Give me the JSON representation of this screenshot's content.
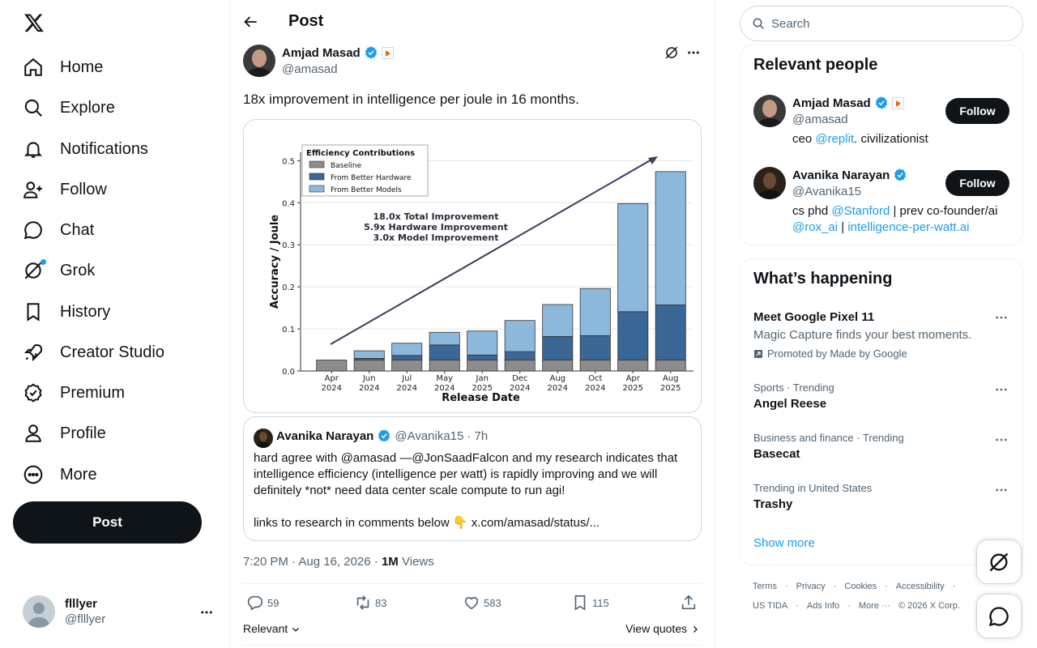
{
  "nav": {
    "items": [
      {
        "label": "Home",
        "icon": "home-icon"
      },
      {
        "label": "Explore",
        "icon": "search-icon"
      },
      {
        "label": "Notifications",
        "icon": "bell-icon"
      },
      {
        "label": "Follow",
        "icon": "person-add-icon"
      },
      {
        "label": "Chat",
        "icon": "chat-icon"
      },
      {
        "label": "Grok",
        "icon": "grok-icon"
      },
      {
        "label": "History",
        "icon": "bookmark-icon"
      },
      {
        "label": "Creator Studio",
        "icon": "rocket-icon"
      },
      {
        "label": "Premium",
        "icon": "verified-badge-icon"
      },
      {
        "label": "Profile",
        "icon": "person-icon"
      },
      {
        "label": "More",
        "icon": "more-circle-icon"
      }
    ],
    "post_button": "Post",
    "account": {
      "name": "flllyer",
      "handle": "@flllyer"
    }
  },
  "header": {
    "title": "Post"
  },
  "tweet": {
    "author": {
      "name": "Amjad Masad",
      "handle": "@amasad"
    },
    "text": "18x improvement in intelligence per joule in 16 months.",
    "quote": {
      "author": "Avanika Narayan",
      "handle": "@Avanika15",
      "time": "· 7h",
      "line1": "hard agree with @amasad —@JonSaadFalcon and my research indicates that",
      "line2": "intelligence efficiency (intelligence per watt) is rapidly improving and we will",
      "line3": "definitely *not* need data center scale compute to run agi!",
      "line4": "links to research in comments below 👇 x.com/amasad/status/..."
    },
    "timestamp": "7:20 PM · Aug 16, 2026 ·",
    "views_count": "1M",
    "views_label": "Views",
    "stats": {
      "replies": "59",
      "reposts": "83",
      "likes": "583",
      "bookmarks": "115"
    },
    "sort_label": "Relevant",
    "view_quotes": "View quotes"
  },
  "chart_data": {
    "type": "bar",
    "stacked": true,
    "xlabel": "Release Date",
    "ylabel": "Accuracy / Joule",
    "ylim": [
      0,
      0.52
    ],
    "yticks": [
      "0.0",
      "0.1",
      "0.2",
      "0.3",
      "0.4",
      "0.5"
    ],
    "legend_title": "Efficiency Contributions",
    "legend_position": "top-left",
    "categories": [
      [
        "Apr",
        "2024"
      ],
      [
        "Jun",
        "2024"
      ],
      [
        "Jul",
        "2024"
      ],
      [
        "May",
        "2024"
      ],
      [
        "Jan",
        "2025"
      ],
      [
        "Dec",
        "2024"
      ],
      [
        "Aug",
        "2024"
      ],
      [
        "Oct",
        "2024"
      ],
      [
        "Apr",
        "2025"
      ],
      [
        "Aug",
        "2025"
      ]
    ],
    "series": [
      {
        "name": "Baseline",
        "color": "#8c8c8c",
        "values": [
          0.026,
          0.026,
          0.026,
          0.026,
          0.026,
          0.026,
          0.026,
          0.026,
          0.026,
          0.026
        ]
      },
      {
        "name": "From Better Hardware",
        "color": "#3b6796",
        "values": [
          0.0,
          0.004,
          0.011,
          0.036,
          0.012,
          0.02,
          0.056,
          0.058,
          0.115,
          0.131
        ]
      },
      {
        "name": "From Better Models",
        "color": "#8cb8dc",
        "values": [
          0.0,
          0.018,
          0.029,
          0.03,
          0.057,
          0.074,
          0.076,
          0.112,
          0.257,
          0.317
        ]
      }
    ],
    "annotations": [
      "18.0x Total Improvement",
      "5.9x Hardware Improvement",
      "3.0x Model Improvement"
    ]
  },
  "sidebar": {
    "search_placeholder": "Search",
    "relevant_title": "Relevant people",
    "people": [
      {
        "name": "Amjad Masad",
        "handle": "@amasad",
        "bio_a": "ceo ",
        "bio_link": "@replit",
        "bio_b": ". civilizationist",
        "follow": "Follow"
      },
      {
        "name": "Avanika Narayan",
        "handle": "@Avanika15",
        "bio_a": "cs phd ",
        "bio_link": "@Stanford",
        "bio_b": " | prev co-founder/ai",
        "bio_link2": "@rox_ai",
        "bio_c": " | ",
        "bio_link3": "intelligence-per-watt.ai",
        "follow": "Follow"
      }
    ],
    "happening_title": "What’s happening",
    "trends": [
      {
        "name": "Meet Google Pixel 11",
        "sub": "Magic Capture finds your best moments.",
        "promo": "Promoted by Made by Google"
      },
      {
        "context": "Sports · Trending",
        "name": "Angel Reese"
      },
      {
        "context": "Business and finance · Trending",
        "name": "Basecat"
      },
      {
        "context": "Trending in United States",
        "name": "Trashy"
      }
    ],
    "show_more": "Show more",
    "footer": [
      "Terms",
      "·",
      "Privacy",
      "·",
      "Cookies",
      "·",
      "Accessibility",
      "·"
    ],
    "footer2": [
      "US TIDA",
      "·",
      "Ads Info",
      "·",
      "More ···",
      "© 2026 X Corp."
    ]
  }
}
